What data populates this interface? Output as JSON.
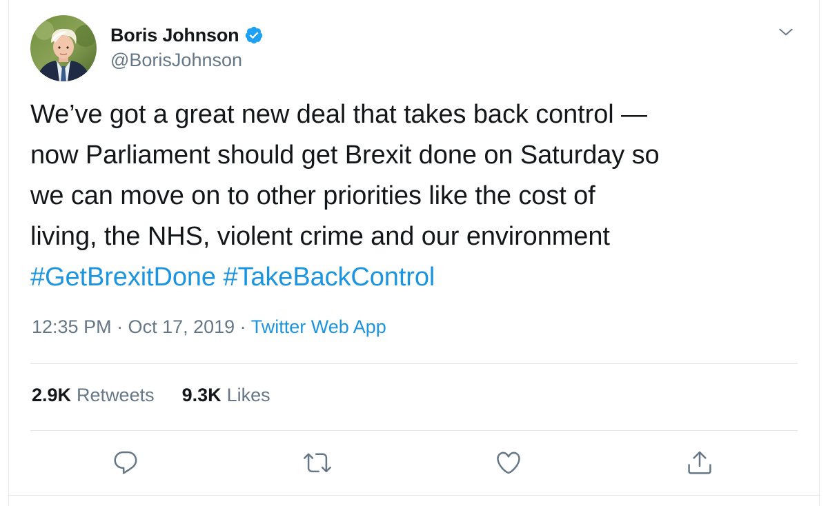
{
  "tweet": {
    "author": {
      "name": "Boris Johnson",
      "handle": "@BorisJohnson",
      "verified": true
    },
    "text_lines": [
      "We’ve got a great new deal that takes back control —",
      "now Parliament should get Brexit done on Saturday so",
      "we can move on to other priorities like the cost of",
      "living, the NHS, violent crime and our environment"
    ],
    "hashtags": [
      "#GetBrexitDone",
      "#TakeBackControl"
    ],
    "timestamp": "12:35 PM · Oct 17, 2019",
    "separator": " · ",
    "source": "Twitter Web App",
    "stats": {
      "retweets_count": "2.9K",
      "retweets_label": "Retweets",
      "likes_count": "9.3K",
      "likes_label": "Likes"
    },
    "actions": [
      "reply-icon",
      "retweet-icon",
      "like-icon",
      "share-icon"
    ]
  },
  "colors": {
    "text": "#14171a",
    "secondary": "#657786",
    "link": "#1b95e0",
    "border": "#e1e8ed",
    "verified": "#1da1f2"
  }
}
